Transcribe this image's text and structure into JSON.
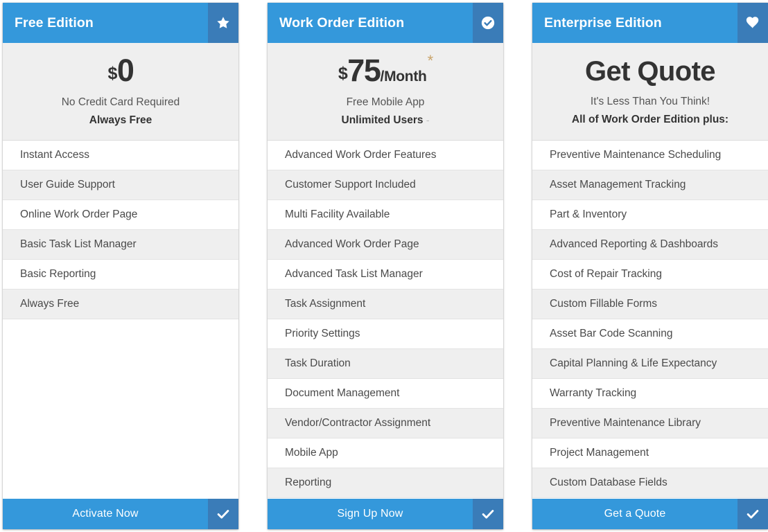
{
  "theme": {
    "accent": "#3498db",
    "accent_dark": "#3a7cb8",
    "panel_bg": "#efefef",
    "row_alt_bg": "#efefef",
    "text": "#4a4a4a",
    "asterisk": "#c9a46a"
  },
  "cards": [
    {
      "title": "Free Edition",
      "badge_icon": "star-icon",
      "price": {
        "currency": "$",
        "amount": "0",
        "period": "",
        "asterisk": "",
        "headline": "",
        "sub1": "No Credit Card Required",
        "sub2": "Always Free",
        "trail_dash": ""
      },
      "features": [
        "Instant Access",
        "User Guide Support",
        "Online Work Order Page",
        "Basic Task List Manager",
        "Basic Reporting",
        "Always Free"
      ],
      "footer": {
        "label": "Activate Now",
        "icon": "check-icon"
      }
    },
    {
      "title": "Work Order Edition",
      "badge_icon": "check-circle-icon",
      "price": {
        "currency": "$",
        "amount": "75",
        "period": "/Month",
        "asterisk": "*",
        "headline": "",
        "sub1": "Free Mobile App",
        "sub2": "Unlimited Users",
        "trail_dash": "-"
      },
      "features": [
        "Advanced Work Order Features",
        "Customer Support Included",
        "Multi Facility Available",
        "Advanced Work Order Page",
        "Advanced Task List Manager",
        "Task Assignment",
        "Priority Settings",
        "Task Duration",
        "Document Management",
        "Vendor/Contractor Assignment",
        "Mobile App",
        "Reporting"
      ],
      "footer": {
        "label": "Sign Up Now",
        "icon": "check-icon"
      }
    },
    {
      "title": "Enterprise Edition",
      "badge_icon": "heart-icon",
      "price": {
        "currency": "",
        "amount": "",
        "period": "",
        "asterisk": "",
        "headline": "Get Quote",
        "sub1": "It's Less Than You Think!",
        "sub2": "All of Work Order Edition plus:",
        "trail_dash": ""
      },
      "features": [
        "Preventive Maintenance Scheduling",
        "Asset Management Tracking",
        "Part & Inventory",
        "Advanced Reporting & Dashboards",
        "Cost of Repair Tracking",
        "Custom Fillable Forms",
        "Asset Bar Code Scanning",
        "Capital Planning & Life Expectancy",
        "Warranty Tracking",
        "Preventive Maintenance Library",
        "Project Management",
        "Custom Database Fields"
      ],
      "footer": {
        "label": "Get a Quote",
        "icon": "check-icon"
      }
    }
  ]
}
